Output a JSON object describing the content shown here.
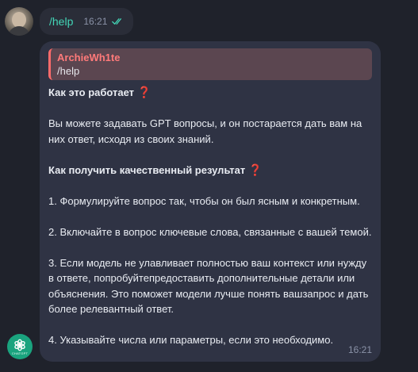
{
  "outgoing": {
    "text": "/help",
    "time": "16:21"
  },
  "incoming": {
    "reply": {
      "author": "ArchieWh1te",
      "text": "/help"
    },
    "heading1": "Как это работает",
    "para1": "Вы можете задавать GPT вопросы, и он постарается дать вам на них ответ, исходя из своих знаний.",
    "heading2": "Как получить качественный результат",
    "item1": "1. Формулируйте вопрос так, чтобы он был ясным и конкретным.",
    "item2": "2. Включайте в вопрос ключевые слова, связанные с вашей темой.",
    "item3": "3. Если модель не улавливает полностью ваш контекст или нужду в ответе, попробуйтепредоставить дополнительные детали или объяснения. Это поможет модели лучше понять вашзапрос и дать более релевантный ответ.",
    "item4": "4. Указывайте числа или параметры, если это необходимо.",
    "time": "16:21",
    "question_mark": "❓"
  },
  "bot_avatar": {
    "label": "CHATGPT",
    "color": "#1aa37e"
  },
  "colors": {
    "background": "#1f222b",
    "incoming_bubble": "#2f3344",
    "outgoing_text": "#43d6b7",
    "reply_name": "#ff7a7a"
  }
}
